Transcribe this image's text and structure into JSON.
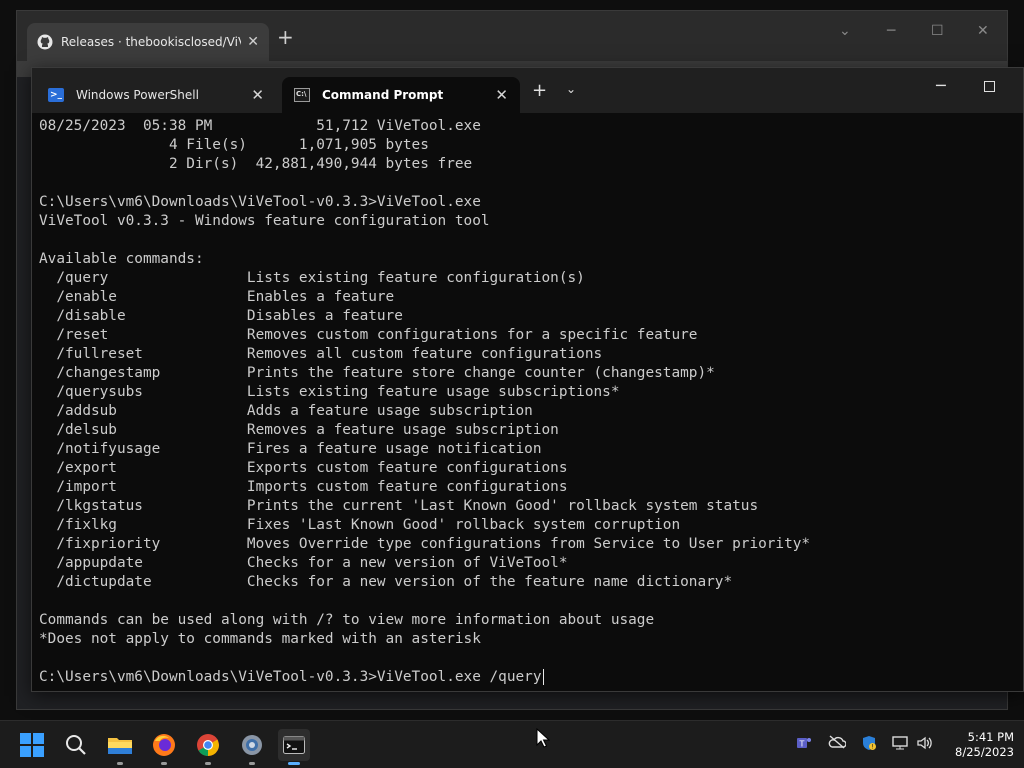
{
  "browser": {
    "tab_title": "Releases · thebookisclosed/ViVe",
    "tab_close": "✕",
    "new_tab": "+"
  },
  "terminal": {
    "tabs": [
      {
        "label": "Windows PowerShell",
        "icon": "powershell-icon",
        "active": false
      },
      {
        "label": "Command Prompt",
        "icon": "cmd-icon",
        "active": true
      }
    ],
    "new_tab": "+",
    "dropdown": "⌄",
    "minimize": "─"
  },
  "console_lines": [
    "08/25/2023  05:38 PM            51,712 ViVeTool.exe",
    "               4 File(s)      1,071,905 bytes",
    "               2 Dir(s)  42,881,490,944 bytes free",
    "",
    "C:\\Users\\vm6\\Downloads\\ViVeTool-v0.3.3>ViVeTool.exe",
    "ViVeTool v0.3.3 - Windows feature configuration tool",
    "",
    "Available commands:",
    "  /query                Lists existing feature configuration(s)",
    "  /enable               Enables a feature",
    "  /disable              Disables a feature",
    "  /reset                Removes custom configurations for a specific feature",
    "  /fullreset            Removes all custom feature configurations",
    "  /changestamp          Prints the feature store change counter (changestamp)*",
    "  /querysubs            Lists existing feature usage subscriptions*",
    "  /addsub               Adds a feature usage subscription",
    "  /delsub               Removes a feature usage subscription",
    "  /notifyusage          Fires a feature usage notification",
    "  /export               Exports custom feature configurations",
    "  /import               Imports custom feature configurations",
    "  /lkgstatus            Prints the current 'Last Known Good' rollback system status",
    "  /fixlkg               Fixes 'Last Known Good' rollback system corruption",
    "  /fixpriority          Moves Override type configurations from Service to User priority*",
    "  /appupdate            Checks for a new version of ViVeTool*",
    "  /dictupdate           Checks for a new version of the feature name dictionary*",
    "",
    "Commands can be used along with /? to view more information about usage",
    "*Does not apply to commands marked with an asterisk",
    ""
  ],
  "prompt_line": "C:\\Users\\vm6\\Downloads\\ViVeTool-v0.3.3>ViVeTool.exe /query",
  "taskbar": {
    "apps": [
      "start-icon",
      "search-icon",
      "file-explorer-icon",
      "firefox-icon",
      "chrome-icon",
      "settings-icon",
      "terminal-icon"
    ],
    "tray": [
      "teams-icon",
      "onedrive-icon",
      "defender-icon",
      "network-icon",
      "volume-icon"
    ],
    "time": "5:41 PM",
    "date": "8/25/2023"
  },
  "colors": {
    "console_bg": "#0c0c0c",
    "console_text": "#cccccc",
    "accent": "#3aa0ff"
  }
}
